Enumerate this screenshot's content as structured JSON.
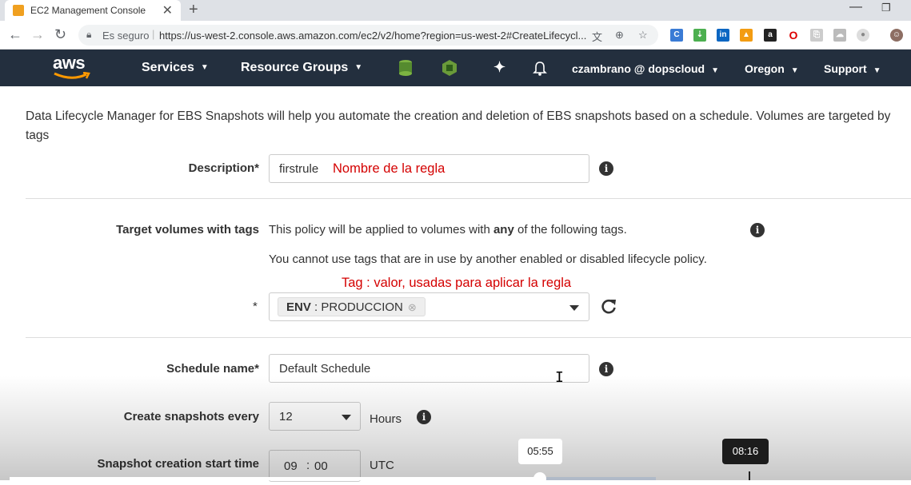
{
  "browser": {
    "tab_title": "EC2 Management Console",
    "tab_close": "✕",
    "new_tab": "+",
    "security_label": "Es seguro",
    "url": "https://us-west-2.console.aws.amazon.com/ec2/v2/home?region=us-west-2#CreateLifecycl...",
    "window_minimize": "—",
    "window_restore": "❐"
  },
  "aws_nav": {
    "logo": "aws",
    "services": "Services",
    "resource_groups": "Resource Groups",
    "account": "czambrano @ dopscloud",
    "region": "Oregon",
    "support": "Support"
  },
  "form": {
    "intro": "Data Lifecycle Manager for EBS Snapshots will help you automate the creation and deletion of EBS snapshots based on a schedule. Volumes are targeted by tags",
    "description_label": "Description*",
    "description_value": "firstrule",
    "description_annotation": "Nombre de la regla",
    "target_label": "Target volumes with tags",
    "target_text_before": "This policy will be applied to volumes with ",
    "target_text_bold": "any",
    "target_text_after": " of the following tags.",
    "target_note": "You cannot use tags that are in use by another enabled or disabled lifecycle policy.",
    "tag_annotation": "Tag : valor, usadas para aplicar la regla",
    "tag_required_mark": "*",
    "tag_key": "ENV",
    "tag_value": "PRODUCCION",
    "schedule_name_label": "Schedule name*",
    "schedule_name_value": "Default Schedule",
    "create_every_label": "Create snapshots every",
    "create_every_value": "12",
    "create_every_unit": "Hours",
    "start_time_label": "Snapshot creation start time",
    "start_time_hour": "09",
    "start_time_colon": ":",
    "start_time_min": "00",
    "start_time_zone": "UTC"
  },
  "video": {
    "current_time": "05:55",
    "hover_time": "08:16"
  },
  "colors": {
    "aws_nav_bg": "#232f3e",
    "annotation_red": "#d40000"
  }
}
